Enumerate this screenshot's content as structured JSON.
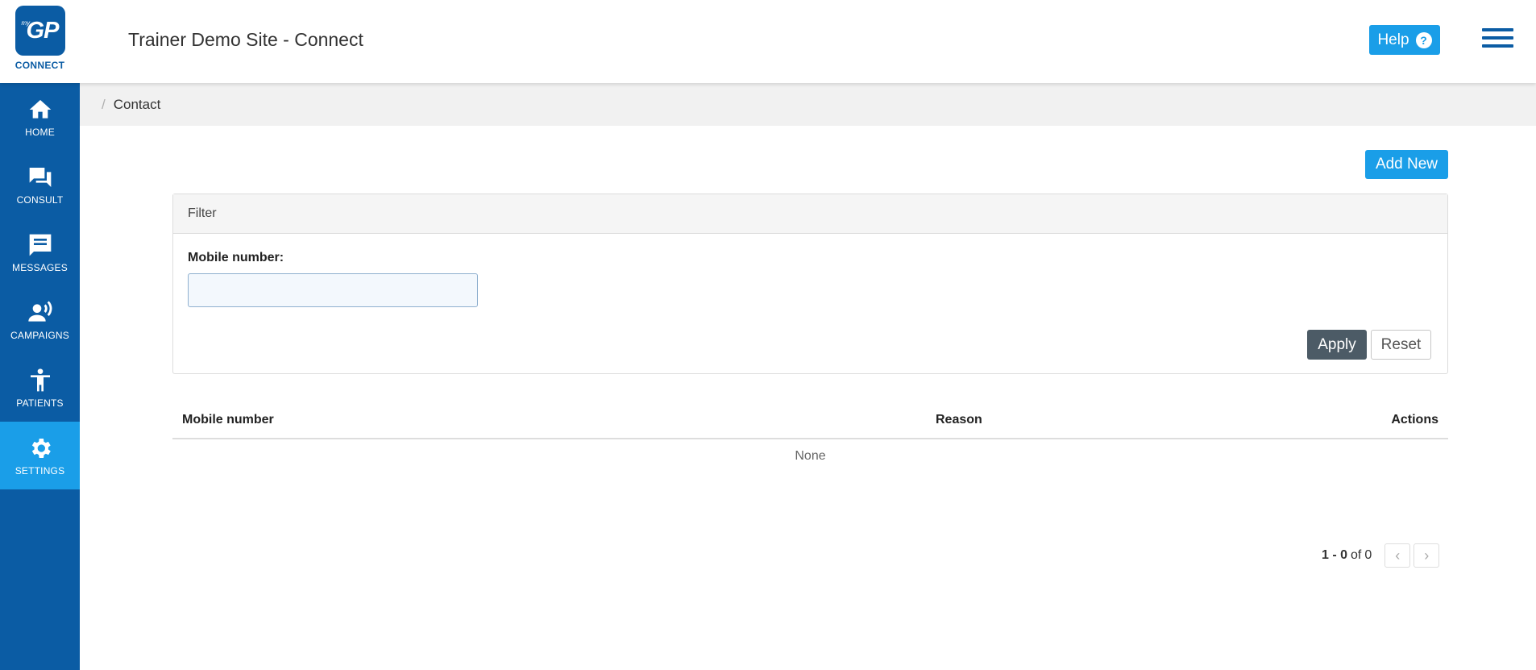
{
  "header": {
    "logo_prefix": "my",
    "logo_text": "GP",
    "logo_caption": "CONNECT",
    "site_title": "Trainer Demo Site - Connect",
    "help_label": "Help",
    "help_icon": "question-circle-icon",
    "menu_icon": "hamburger-menu-icon"
  },
  "sidebar": {
    "items": [
      {
        "label": "HOME",
        "icon": "home-icon",
        "active": false
      },
      {
        "label": "CONSULT",
        "icon": "chat-bubbles-icon",
        "active": false
      },
      {
        "label": "MESSAGES",
        "icon": "message-icon",
        "active": false
      },
      {
        "label": "CAMPAIGNS",
        "icon": "broadcast-person-icon",
        "active": false
      },
      {
        "label": "PATIENTS",
        "icon": "person-icon",
        "active": false
      },
      {
        "label": "SETTINGS",
        "icon": "gear-icon",
        "active": true
      }
    ]
  },
  "breadcrumb": {
    "separator": "/",
    "current": "Contact"
  },
  "main": {
    "add_new_label": "Add New",
    "filter": {
      "title": "Filter",
      "mobile_label": "Mobile number:",
      "mobile_value": "",
      "mobile_placeholder": "",
      "apply_label": "Apply",
      "reset_label": "Reset"
    },
    "table": {
      "columns": [
        "Mobile number",
        "Reason",
        "Actions"
      ],
      "rows": [],
      "empty_text": "None"
    },
    "pagination": {
      "range": "1 - 0",
      "of_text": "of",
      "total": "0",
      "prev_icon": "chevron-left-icon",
      "next_icon": "chevron-right-icon"
    }
  },
  "colors": {
    "brand_blue": "#0b5ca4",
    "accent_blue": "#1a9ee8",
    "apply_gray": "#4c5b66"
  }
}
